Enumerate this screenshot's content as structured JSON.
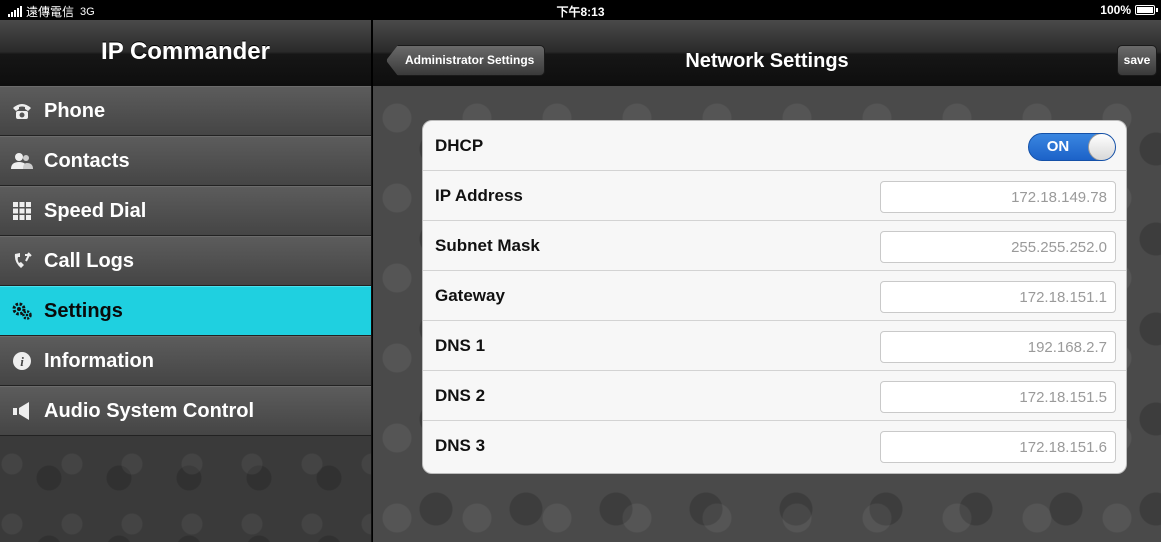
{
  "status_bar": {
    "carrier": "遠傳電信",
    "network": "3G",
    "time": "下午8:13",
    "battery": "100%"
  },
  "left_header": {
    "title": "IP Commander"
  },
  "sidebar": {
    "items": [
      {
        "label": "Phone",
        "icon": "telephone-icon",
        "active": false
      },
      {
        "label": "Contacts",
        "icon": "people-icon",
        "active": false
      },
      {
        "label": "Speed Dial",
        "icon": "keypad-icon",
        "active": false
      },
      {
        "label": "Call Logs",
        "icon": "call-log-icon",
        "active": false
      },
      {
        "label": "Settings",
        "icon": "gears-icon",
        "active": true
      },
      {
        "label": "Information",
        "icon": "info-icon",
        "active": false
      },
      {
        "label": "Audio System Control",
        "icon": "speaker-icon",
        "active": false
      }
    ],
    "active_color": "#1fd0e0"
  },
  "right_header": {
    "back_label": "Administrator Settings",
    "title": "Network Settings",
    "save_label": "save"
  },
  "network": {
    "dhcp": {
      "label": "DHCP",
      "state": "ON"
    },
    "fields": [
      {
        "label": "IP Address",
        "value": "172.18.149.78"
      },
      {
        "label": "Subnet Mask",
        "value": "255.255.252.0"
      },
      {
        "label": "Gateway",
        "value": "172.18.151.1"
      },
      {
        "label": "DNS 1",
        "value": "192.168.2.7"
      },
      {
        "label": "DNS 2",
        "value": "172.18.151.5"
      },
      {
        "label": "DNS 3",
        "value": "172.18.151.6"
      }
    ]
  }
}
